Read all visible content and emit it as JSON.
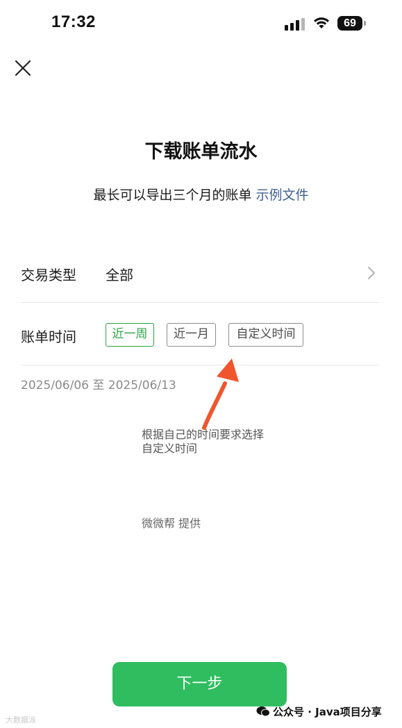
{
  "status_bar": {
    "time": "17:32",
    "battery": "69"
  },
  "header": {
    "title": "下载账单流水",
    "subtitle": "最长可以导出三个月的账单",
    "sample_link": "示例文件"
  },
  "transaction_type": {
    "label": "交易类型",
    "value": "全部"
  },
  "bill_time": {
    "label": "账单时间",
    "options": [
      "近一周",
      "近一月",
      "自定义时间"
    ],
    "selected": "近一周",
    "range": "2025/06/06 至 2025/06/13"
  },
  "annotation": {
    "line1": "根据自己的时间要求选择",
    "line2": "自定义时间"
  },
  "provider": "微微帮 提供",
  "next_button": "下一步",
  "watermark": {
    "right": "公众号 · Java项目分享",
    "left": "大数据派"
  },
  "colors": {
    "accent_green": "#2fbd5f",
    "chip_green": "#2ba244",
    "link_blue": "#3f5e90",
    "arrow_red": "#f0552e"
  }
}
